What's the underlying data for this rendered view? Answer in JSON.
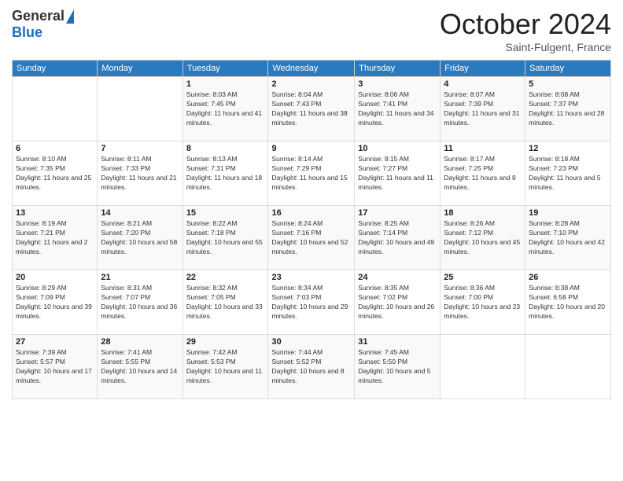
{
  "logo": {
    "general": "General",
    "blue": "Blue"
  },
  "header": {
    "month": "October 2024",
    "location": "Saint-Fulgent, France"
  },
  "weekdays": [
    "Sunday",
    "Monday",
    "Tuesday",
    "Wednesday",
    "Thursday",
    "Friday",
    "Saturday"
  ],
  "weeks": [
    [
      {
        "day": "",
        "info": ""
      },
      {
        "day": "",
        "info": ""
      },
      {
        "day": "1",
        "info": "Sunrise: 8:03 AM\nSunset: 7:45 PM\nDaylight: 11 hours and 41 minutes."
      },
      {
        "day": "2",
        "info": "Sunrise: 8:04 AM\nSunset: 7:43 PM\nDaylight: 11 hours and 38 minutes."
      },
      {
        "day": "3",
        "info": "Sunrise: 8:06 AM\nSunset: 7:41 PM\nDaylight: 11 hours and 34 minutes."
      },
      {
        "day": "4",
        "info": "Sunrise: 8:07 AM\nSunset: 7:39 PM\nDaylight: 11 hours and 31 minutes."
      },
      {
        "day": "5",
        "info": "Sunrise: 8:08 AM\nSunset: 7:37 PM\nDaylight: 11 hours and 28 minutes."
      }
    ],
    [
      {
        "day": "6",
        "info": "Sunrise: 8:10 AM\nSunset: 7:35 PM\nDaylight: 11 hours and 25 minutes."
      },
      {
        "day": "7",
        "info": "Sunrise: 8:11 AM\nSunset: 7:33 PM\nDaylight: 11 hours and 21 minutes."
      },
      {
        "day": "8",
        "info": "Sunrise: 8:13 AM\nSunset: 7:31 PM\nDaylight: 11 hours and 18 minutes."
      },
      {
        "day": "9",
        "info": "Sunrise: 8:14 AM\nSunset: 7:29 PM\nDaylight: 11 hours and 15 minutes."
      },
      {
        "day": "10",
        "info": "Sunrise: 8:15 AM\nSunset: 7:27 PM\nDaylight: 11 hours and 11 minutes."
      },
      {
        "day": "11",
        "info": "Sunrise: 8:17 AM\nSunset: 7:25 PM\nDaylight: 11 hours and 8 minutes."
      },
      {
        "day": "12",
        "info": "Sunrise: 8:18 AM\nSunset: 7:23 PM\nDaylight: 11 hours and 5 minutes."
      }
    ],
    [
      {
        "day": "13",
        "info": "Sunrise: 8:19 AM\nSunset: 7:21 PM\nDaylight: 11 hours and 2 minutes."
      },
      {
        "day": "14",
        "info": "Sunrise: 8:21 AM\nSunset: 7:20 PM\nDaylight: 10 hours and 58 minutes."
      },
      {
        "day": "15",
        "info": "Sunrise: 8:22 AM\nSunset: 7:18 PM\nDaylight: 10 hours and 55 minutes."
      },
      {
        "day": "16",
        "info": "Sunrise: 8:24 AM\nSunset: 7:16 PM\nDaylight: 10 hours and 52 minutes."
      },
      {
        "day": "17",
        "info": "Sunrise: 8:25 AM\nSunset: 7:14 PM\nDaylight: 10 hours and 49 minutes."
      },
      {
        "day": "18",
        "info": "Sunrise: 8:26 AM\nSunset: 7:12 PM\nDaylight: 10 hours and 45 minutes."
      },
      {
        "day": "19",
        "info": "Sunrise: 8:28 AM\nSunset: 7:10 PM\nDaylight: 10 hours and 42 minutes."
      }
    ],
    [
      {
        "day": "20",
        "info": "Sunrise: 8:29 AM\nSunset: 7:09 PM\nDaylight: 10 hours and 39 minutes."
      },
      {
        "day": "21",
        "info": "Sunrise: 8:31 AM\nSunset: 7:07 PM\nDaylight: 10 hours and 36 minutes."
      },
      {
        "day": "22",
        "info": "Sunrise: 8:32 AM\nSunset: 7:05 PM\nDaylight: 10 hours and 33 minutes."
      },
      {
        "day": "23",
        "info": "Sunrise: 8:34 AM\nSunset: 7:03 PM\nDaylight: 10 hours and 29 minutes."
      },
      {
        "day": "24",
        "info": "Sunrise: 8:35 AM\nSunset: 7:02 PM\nDaylight: 10 hours and 26 minutes."
      },
      {
        "day": "25",
        "info": "Sunrise: 8:36 AM\nSunset: 7:00 PM\nDaylight: 10 hours and 23 minutes."
      },
      {
        "day": "26",
        "info": "Sunrise: 8:38 AM\nSunset: 6:58 PM\nDaylight: 10 hours and 20 minutes."
      }
    ],
    [
      {
        "day": "27",
        "info": "Sunrise: 7:39 AM\nSunset: 5:57 PM\nDaylight: 10 hours and 17 minutes."
      },
      {
        "day": "28",
        "info": "Sunrise: 7:41 AM\nSunset: 5:55 PM\nDaylight: 10 hours and 14 minutes."
      },
      {
        "day": "29",
        "info": "Sunrise: 7:42 AM\nSunset: 5:53 PM\nDaylight: 10 hours and 11 minutes."
      },
      {
        "day": "30",
        "info": "Sunrise: 7:44 AM\nSunset: 5:52 PM\nDaylight: 10 hours and 8 minutes."
      },
      {
        "day": "31",
        "info": "Sunrise: 7:45 AM\nSunset: 5:50 PM\nDaylight: 10 hours and 5 minutes."
      },
      {
        "day": "",
        "info": ""
      },
      {
        "day": "",
        "info": ""
      }
    ]
  ]
}
